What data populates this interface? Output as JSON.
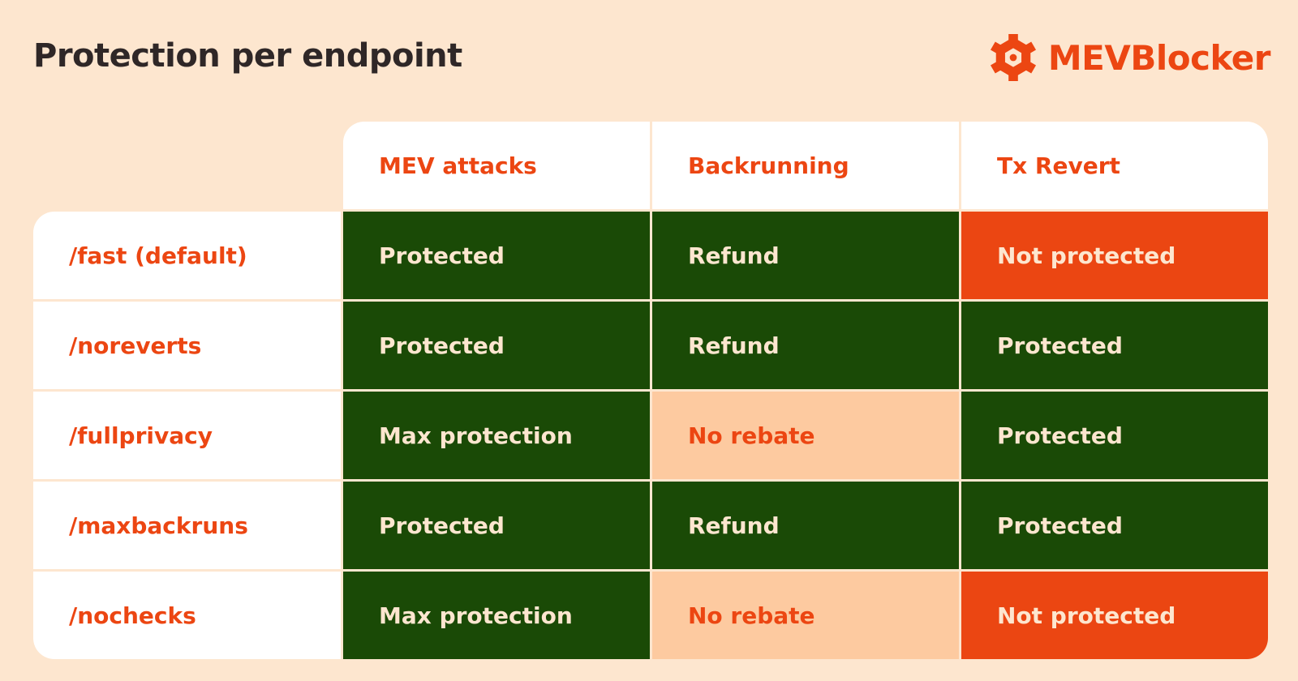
{
  "title": "Protection per endpoint",
  "brand": {
    "name": "MEVBlocker",
    "icon": "hex-nut-logo-icon",
    "color": "#ec4612"
  },
  "colors": {
    "background": "#fde6cf",
    "protected_green": "#1a4a06",
    "not_protected_red": "#eb4612",
    "no_rebate_peach": "#fdcaa0",
    "accent_text": "#ec4612",
    "light_text": "#fde6cf"
  },
  "table": {
    "columns": [
      "MEV attacks",
      "Backrunning",
      "Tx Revert"
    ],
    "rows": [
      {
        "endpoint": "/fast (default)",
        "cells": [
          {
            "text": "Protected",
            "status": "green"
          },
          {
            "text": "Refund",
            "status": "green"
          },
          {
            "text": "Not protected",
            "status": "red"
          }
        ]
      },
      {
        "endpoint": "/noreverts",
        "cells": [
          {
            "text": "Protected",
            "status": "green"
          },
          {
            "text": "Refund",
            "status": "green"
          },
          {
            "text": "Protected",
            "status": "green"
          }
        ]
      },
      {
        "endpoint": "/fullprivacy",
        "cells": [
          {
            "text": "Max protection",
            "status": "green"
          },
          {
            "text": "No rebate",
            "status": "peach"
          },
          {
            "text": "Protected",
            "status": "green"
          }
        ]
      },
      {
        "endpoint": "/maxbackruns",
        "cells": [
          {
            "text": "Protected",
            "status": "green"
          },
          {
            "text": "Refund",
            "status": "green"
          },
          {
            "text": "Protected",
            "status": "green"
          }
        ]
      },
      {
        "endpoint": "/nochecks",
        "cells": [
          {
            "text": "Max protection",
            "status": "green"
          },
          {
            "text": "No rebate",
            "status": "peach"
          },
          {
            "text": "Not protected",
            "status": "red"
          }
        ]
      }
    ]
  }
}
